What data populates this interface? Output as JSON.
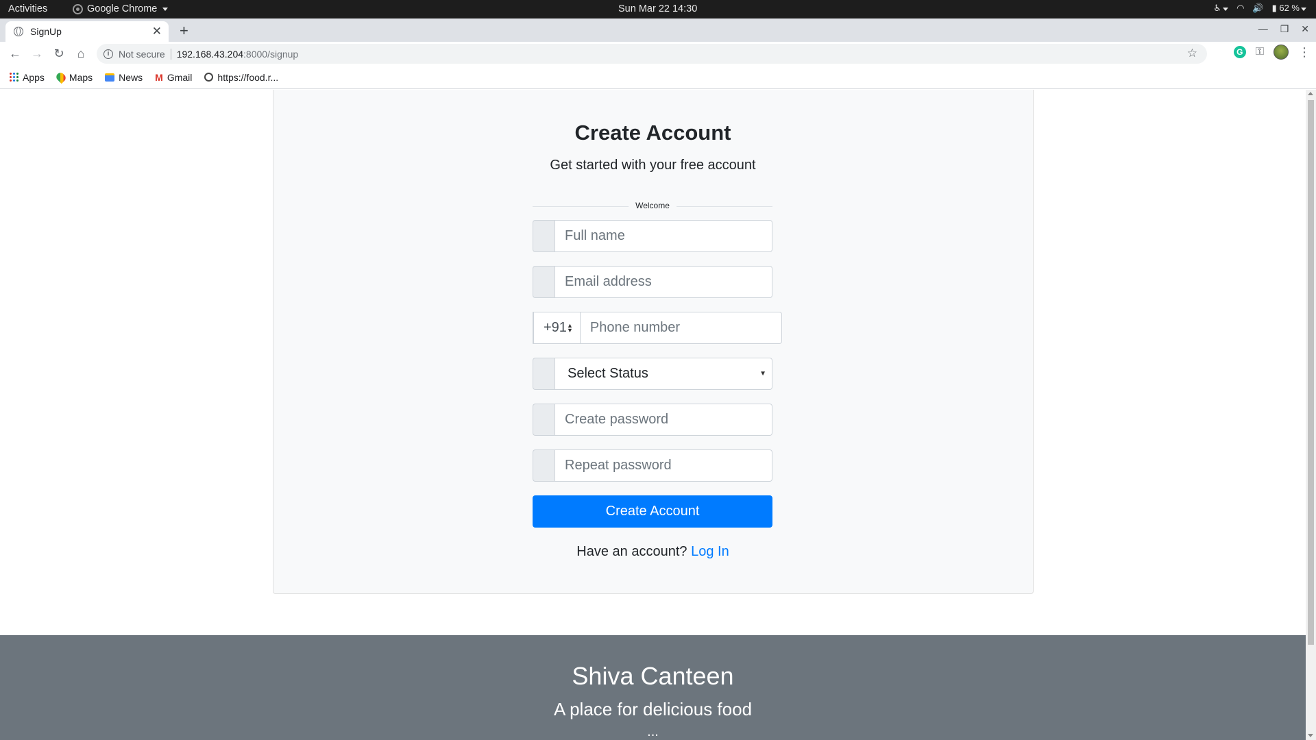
{
  "system_bar": {
    "activities": "Activities",
    "app_name": "Google Chrome",
    "clock": "Sun Mar 22  14:30",
    "battery": "62 %"
  },
  "browser": {
    "tab_title": "SignUp",
    "security_label": "Not secure",
    "url_host": "192.168.43.204",
    "url_path": ":8000/signup",
    "bookmarks": [
      {
        "label": "Apps",
        "icon": "apps-grid-icon"
      },
      {
        "label": "Maps",
        "icon": "maps-icon"
      },
      {
        "label": "News",
        "icon": "news-icon"
      },
      {
        "label": "Gmail",
        "icon": "gmail-icon"
      },
      {
        "label": "https://food.r...",
        "icon": "globe-icon"
      }
    ]
  },
  "signup": {
    "title": "Create Account",
    "subtitle": "Get started with your free account",
    "divider_label": "Welcome",
    "full_name_placeholder": "Full name",
    "email_placeholder": "Email address",
    "country_code": "+91",
    "phone_placeholder": "Phone number",
    "status_select": "Select Status",
    "password_placeholder": "Create password",
    "repeat_password_placeholder": "Repeat password",
    "submit_label": "Create Account",
    "have_account_text": "Have an account?",
    "login_link": "Log In"
  },
  "footer": {
    "name": "Shiva Canteen",
    "tagline": "A place for delicious food",
    "more": "..."
  },
  "colors": {
    "primary": "#007bff",
    "footer_bg": "#6c757d",
    "card_bg": "#f8f9fa"
  }
}
